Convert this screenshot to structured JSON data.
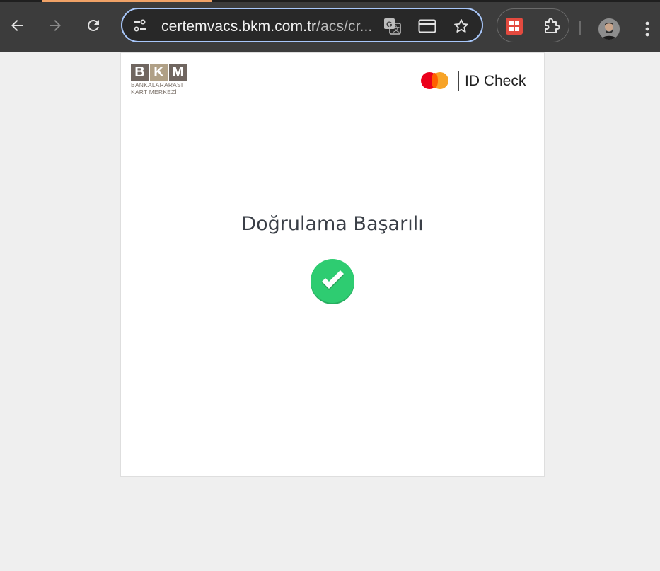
{
  "browser": {
    "url_host": "certemvacs.bkm.com.tr",
    "url_path": "/acs/cr..."
  },
  "icons": {
    "back": "back-arrow-icon",
    "forward": "forward-arrow-icon",
    "reload": "reload-icon",
    "site_settings": "tune-icon",
    "translate": "translate-icon",
    "card": "credit-card-icon",
    "bookmark": "star-icon",
    "extension_apps": "apps-grid-icon",
    "extensions": "puzzle-icon",
    "menu": "more-vert-icon"
  },
  "colors": {
    "omnibox_border": "#a8c7fa",
    "success_green": "#2ecc71",
    "mc_red": "#eb001b",
    "mc_orange": "#f79e1b"
  },
  "page": {
    "bkm_letters": [
      "B",
      "K",
      "M"
    ],
    "bkm_subtitle_line1": "BANKALARARASI",
    "bkm_subtitle_line2": "KART MERKEZİ",
    "idcheck_label": "ID Check",
    "status_title": "Doğrulama Başarılı"
  }
}
